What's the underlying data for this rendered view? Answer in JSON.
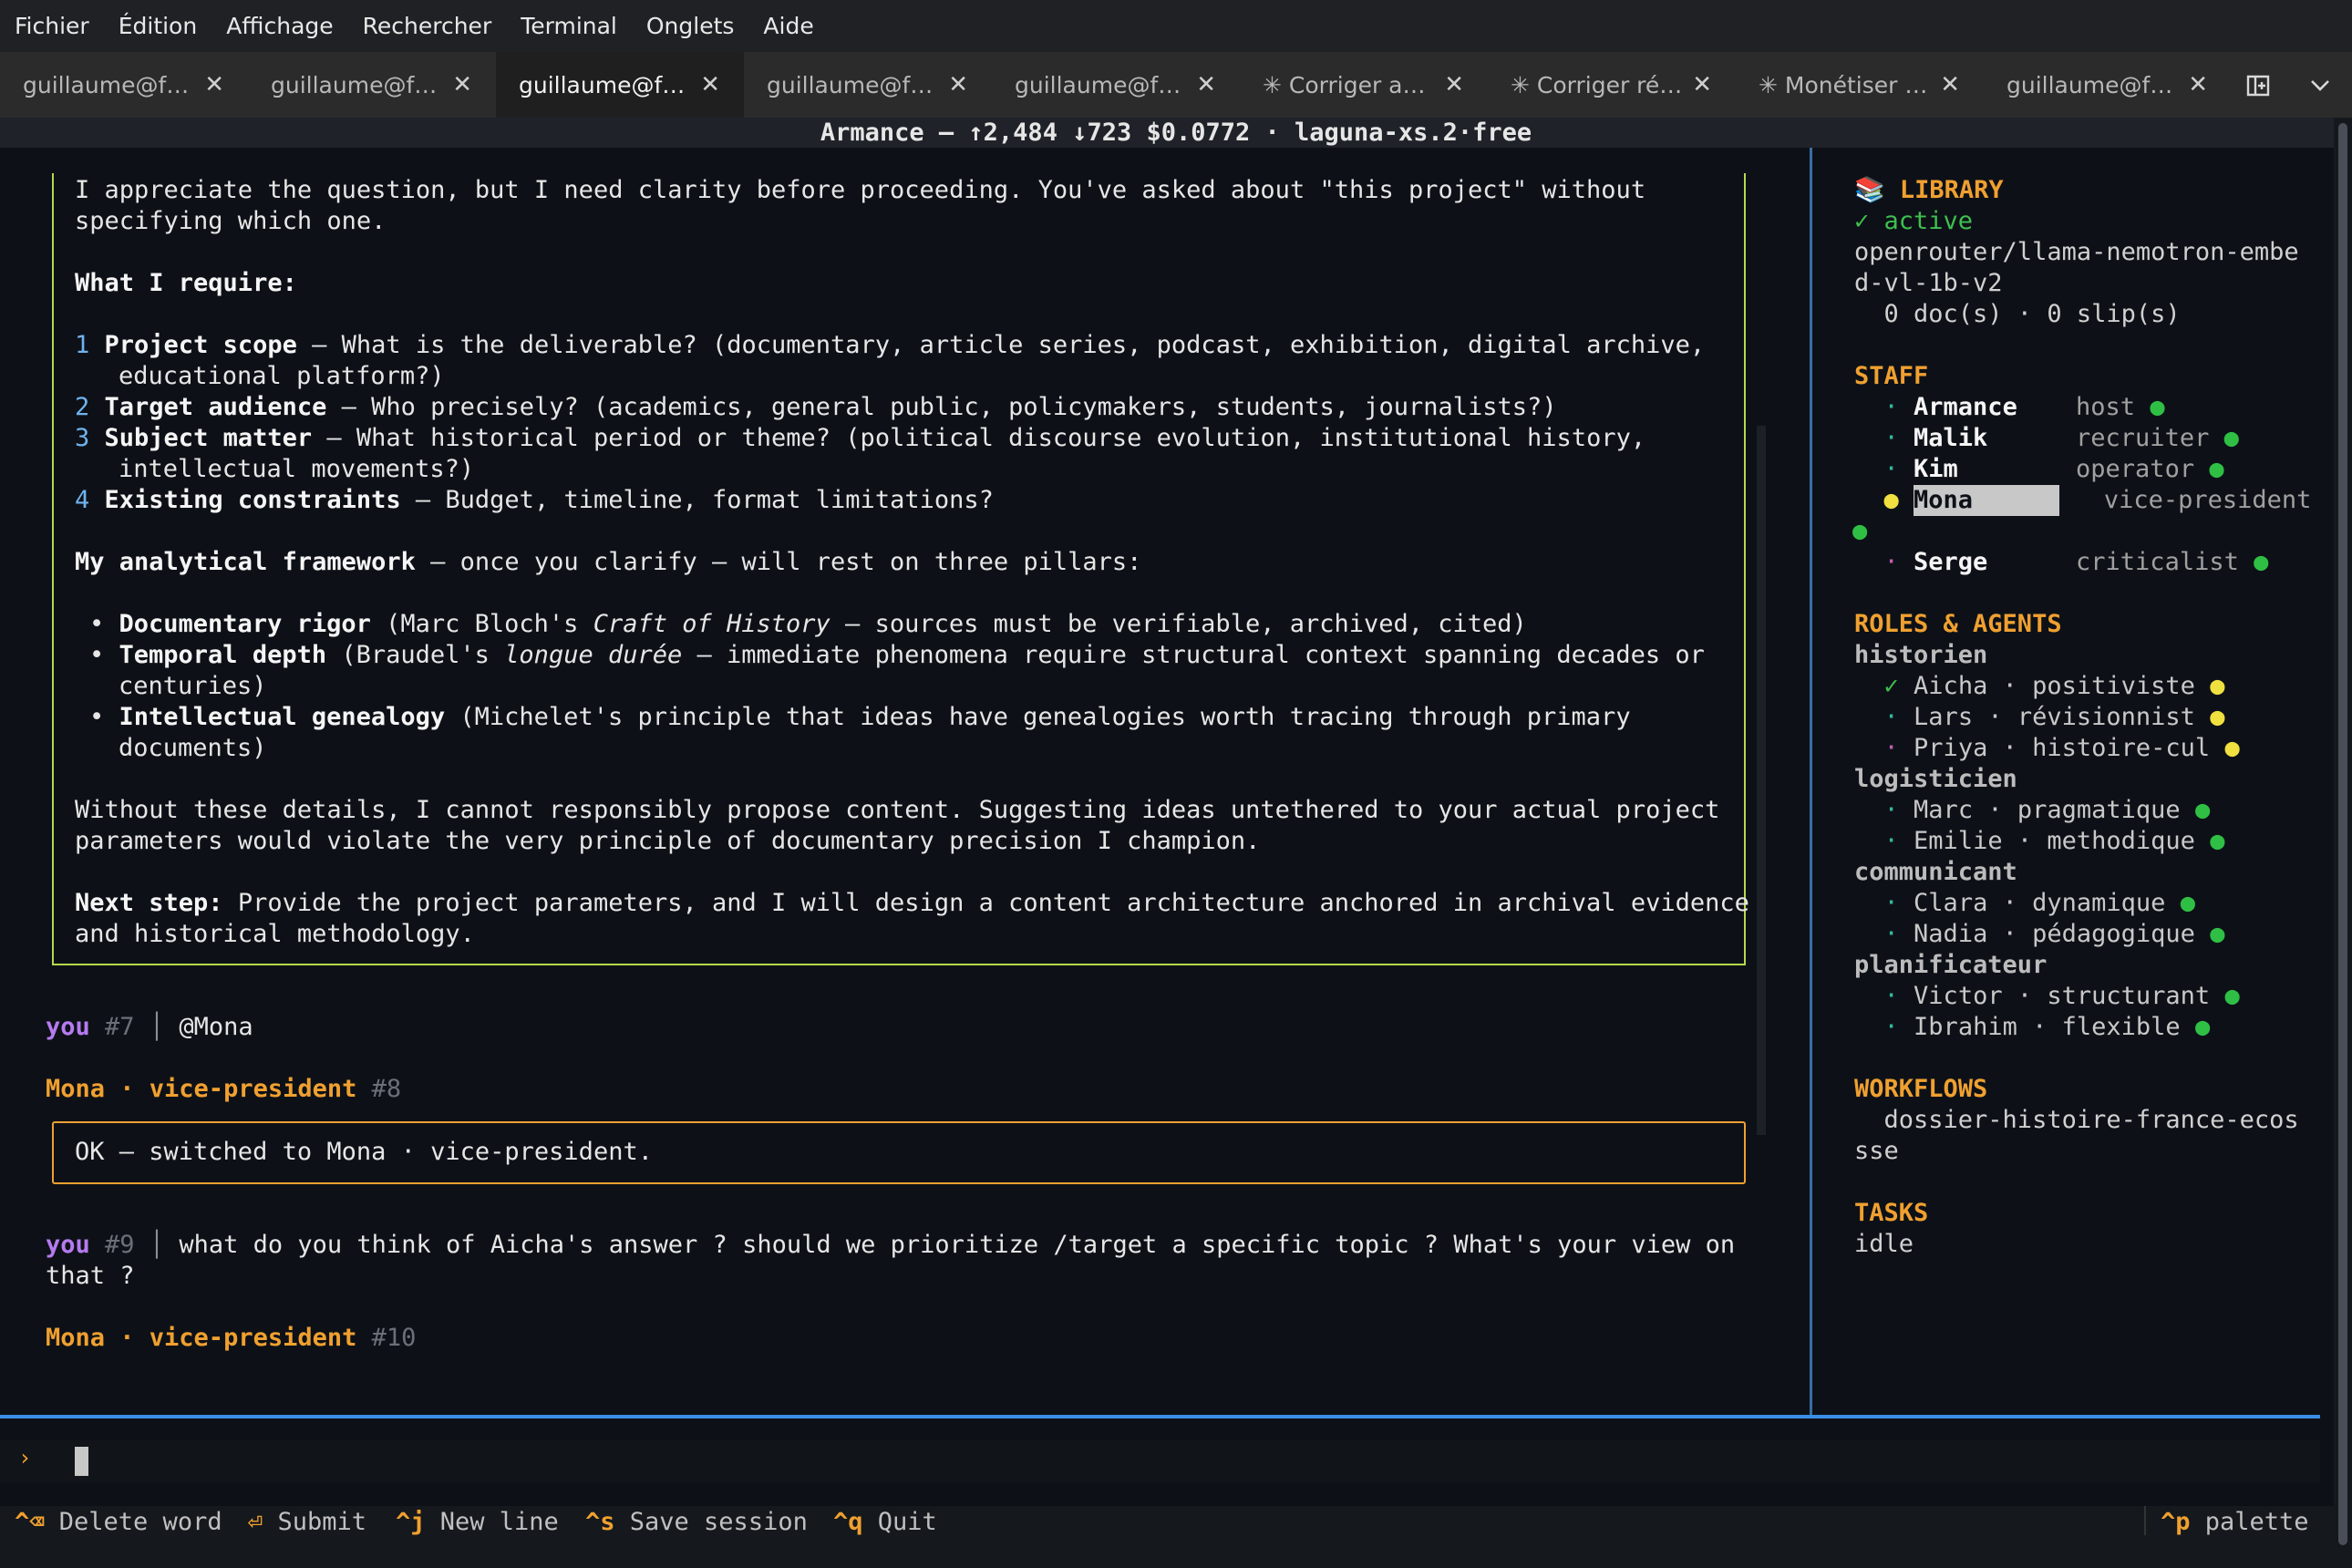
{
  "menubar": [
    "Fichier",
    "Édition",
    "Affichage",
    "Rechercher",
    "Terminal",
    "Onglets",
    "Aide"
  ],
  "tabs": [
    {
      "label": "guillaume@f…",
      "active": false
    },
    {
      "label": "guillaume@f…",
      "active": false
    },
    {
      "label": "guillaume@f…",
      "active": true
    },
    {
      "label": "guillaume@f…",
      "active": false
    },
    {
      "label": "guillaume@f…",
      "active": false
    },
    {
      "label": "✳ Corriger a…",
      "active": false
    },
    {
      "label": "✳ Corriger ré…",
      "active": false
    },
    {
      "label": "✳ Monétiser …",
      "active": false
    },
    {
      "label": "guillaume@f…",
      "active": false
    }
  ],
  "tab_close": "✕",
  "title": "Armance — ↑2,484 ↓723 $0.0772 · laguna-xs.2·free",
  "answer": {
    "intro1": "I appreciate the question, but I need clarity before proceeding. You've asked about \"this project\" without",
    "intro2": "specifying which one.",
    "require_heading": "What I require:",
    "items": [
      {
        "n": "1",
        "title": "Project scope",
        "text": " — What is the deliverable? (documentary, article series, podcast, exhibition, digital archive,",
        "cont": "educational platform?)"
      },
      {
        "n": "2",
        "title": "Target audience",
        "text": " — Who precisely? (academics, general public, policymakers, students, journalists?)",
        "cont": ""
      },
      {
        "n": "3",
        "title": "Subject matter",
        "text": " — What historical period or theme? (political discourse evolution, institutional history,",
        "cont": "intellectual movements?)"
      },
      {
        "n": "4",
        "title": "Existing constraints",
        "text": " — Budget, timeline, format limitations?",
        "cont": ""
      }
    ],
    "framework_heading": "My analytical framework",
    "framework_text": " — once you clarify — will rest on three pillars:",
    "pillars": [
      {
        "title": "Documentary rigor",
        "a": " (Marc Bloch's ",
        "em": "Craft of History",
        "b": " — sources must be verifiable, archived, cited)",
        "cont": ""
      },
      {
        "title": "Temporal depth",
        "a": " (Braudel's ",
        "em": "longue durée",
        "b": " — immediate phenomena require structural context spanning decades or",
        "cont": "centuries)"
      },
      {
        "title": "Intellectual genealogy",
        "a": " (Michelet's principle that ideas have genealogies worth tracing through primary",
        "em": "",
        "b": "",
        "cont": "documents)"
      }
    ],
    "without1": "Without these details, I cannot responsibly propose content. Suggesting ideas untethered to your actual project",
    "without2": "parameters would violate the very principle of documentary precision I champion.",
    "next_label": "Next step:",
    "next1": " Provide the project parameters, and I will design a content architecture anchored in archival evidence",
    "next2": "and historical methodology."
  },
  "messages": {
    "you7": {
      "who": "you",
      "num": "#7",
      "text": "@Mona"
    },
    "mona8": {
      "who": "Mona · vice-president",
      "num": "#8"
    },
    "ok": "OK — switched to Mona · vice-president.",
    "you9": {
      "who": "you",
      "num": "#9",
      "text1": "what do you think of Aicha's answer ? should we prioritize /target a specific topic ? What's your view on",
      "text2": "that ?"
    },
    "mona10": {
      "who": "Mona · vice-president",
      "num": "#10"
    }
  },
  "sidebar": {
    "library": {
      "heading": "📚 LIBRARY",
      "status": "✓ active",
      "model1": "openrouter/llama-nemotron-embe",
      "model2": "d-vl-1b-v2",
      "counts": "  0 doc(s) · 0 slip(s)"
    },
    "staff": {
      "heading": "STAFF",
      "members": [
        {
          "name": "Armance",
          "role": "host"
        },
        {
          "name": "Malik",
          "role": "recruiter"
        },
        {
          "name": "Kim",
          "role": "operator"
        },
        {
          "name": "Mona",
          "role": "vice-president"
        },
        {
          "name": "Serge",
          "role": "criticalist"
        }
      ]
    },
    "roles": {
      "heading": "ROLES & AGENTS",
      "groups": [
        {
          "role": "historien",
          "agents": [
            {
              "mark": "✓",
              "name": "Aicha",
              "style": "positiviste",
              "status": "yellow"
            },
            {
              "mark": "·",
              "name": "Lars",
              "style": "révisionnist",
              "status": "yellow"
            },
            {
              "mark": "·",
              "name": "Priya",
              "style": "histoire-cul",
              "status": "yellow"
            }
          ]
        },
        {
          "role": "logisticien",
          "agents": [
            {
              "mark": "·",
              "name": "Marc",
              "style": "pragmatique",
              "status": "green"
            },
            {
              "mark": "·",
              "name": "Emilie",
              "style": "methodique",
              "status": "green"
            }
          ]
        },
        {
          "role": "communicant",
          "agents": [
            {
              "mark": "·",
              "name": "Clara",
              "style": "dynamique",
              "status": "green"
            },
            {
              "mark": "·",
              "name": "Nadia",
              "style": "pédagogique",
              "status": "green"
            }
          ]
        },
        {
          "role": "planificateur",
          "agents": [
            {
              "mark": "·",
              "name": "Victor",
              "style": "structurant",
              "status": "green"
            },
            {
              "mark": "·",
              "name": "Ibrahim",
              "style": "flexible",
              "status": "green"
            }
          ]
        }
      ]
    },
    "workflows": {
      "heading": "WORKFLOWS",
      "item1": "  dossier-histoire-france-ecos",
      "item2": "sse"
    },
    "tasks": {
      "heading": "TASKS",
      "status": "idle"
    }
  },
  "input": {
    "prompt": "›"
  },
  "footer": {
    "items": [
      {
        "key": "^⌫",
        "label": " Delete word"
      },
      {
        "key": "⏎",
        "label": " Submit"
      },
      {
        "key": "^j",
        "label": " New line"
      },
      {
        "key": "^s",
        "label": " Save session"
      },
      {
        "key": "^q",
        "label": " Quit"
      }
    ],
    "palette_key": "^p",
    "palette_label": " palette"
  },
  "colors": {
    "accent_orange": "#f0a030",
    "answer_border": "#b5d94a",
    "you": "#b57bf0",
    "divider": "#3a6ea5",
    "input_line": "#3a8ee6"
  }
}
